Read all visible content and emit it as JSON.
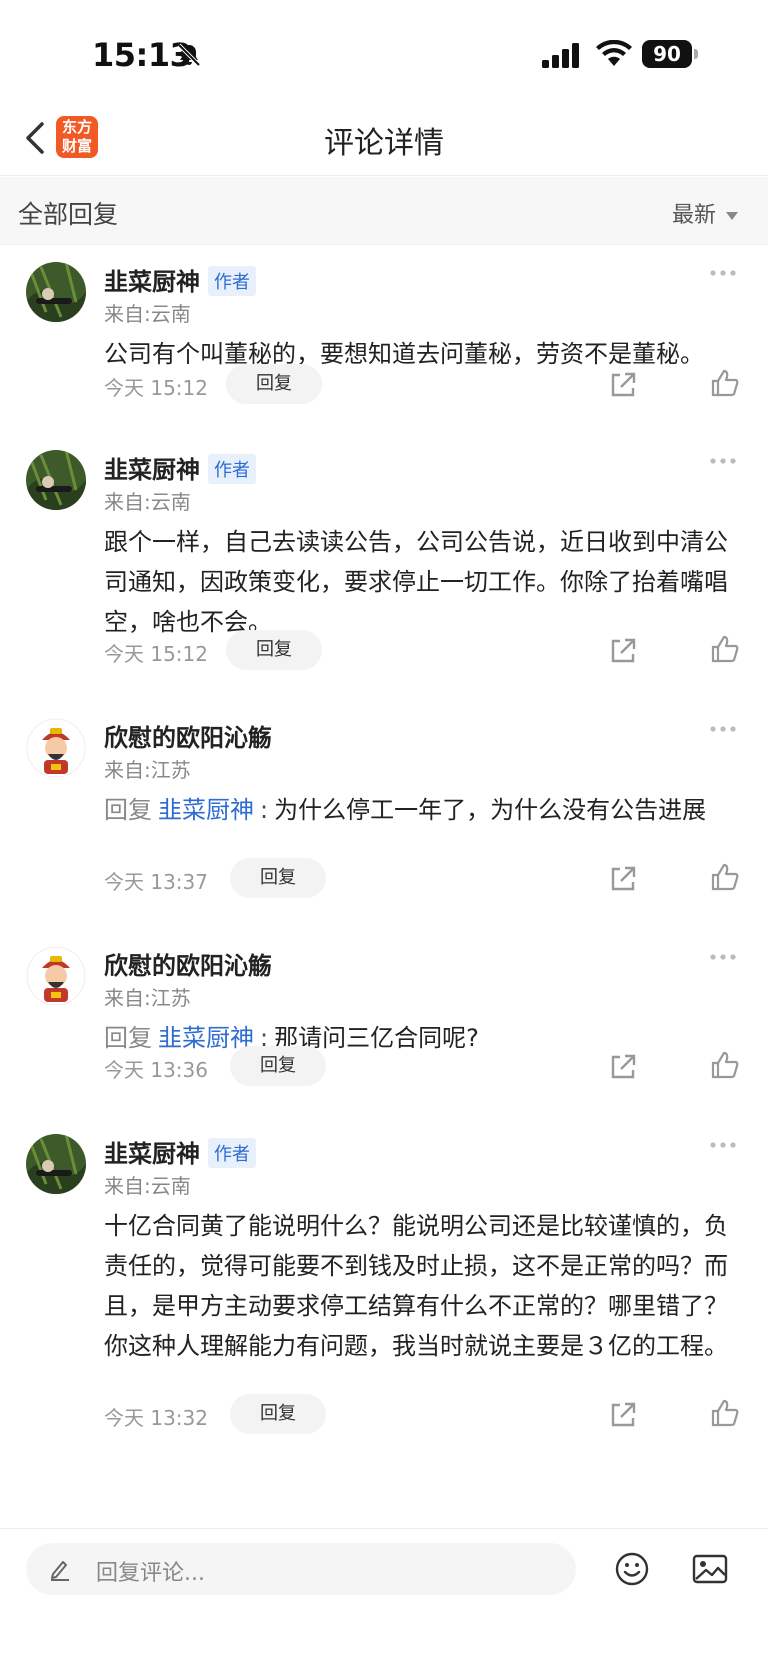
{
  "status_bar": {
    "time": "15:13",
    "battery": "90"
  },
  "nav": {
    "logo_line1": "东方",
    "logo_line2": "财富",
    "title": "评论详情"
  },
  "section": {
    "title": "全部回复",
    "sort": "最新"
  },
  "comments": [
    {
      "user": "韭菜厨神",
      "tag": "作者",
      "location": "来自:云南",
      "text": "公司有个叫董秘的，要想知道去问董秘，劳资不是董秘。",
      "time": "今天 15:12",
      "reply_label": "回复"
    },
    {
      "user": "韭菜厨神",
      "tag": "作者",
      "location": "来自:云南",
      "text": "跟个一样，自己去读读公告，公司公告说，近日收到中清公司通知，因政策变化，要求停止一切工作。你除了抬着嘴唱空，啥也不会。",
      "time": "今天 15:12",
      "reply_label": "回复"
    },
    {
      "user": "欣慰的欧阳沁觞",
      "location": "来自:江苏",
      "reply_prefix": "回复",
      "reply_to": "韭菜厨神",
      "text": "为什么停工一年了，为什么没有公告进展",
      "time": "今天 13:37",
      "reply_label": "回复"
    },
    {
      "user": "欣慰的欧阳沁觞",
      "location": "来自:江苏",
      "reply_prefix": "回复",
      "reply_to": "韭菜厨神",
      "text": "那请问三亿合同呢?",
      "time": "今天 13:36",
      "reply_label": "回复"
    },
    {
      "user": "韭菜厨神",
      "tag": "作者",
      "location": "来自:云南",
      "text": "十亿合同黄了能说明什么？能说明公司还是比较谨慎的，负责任的，觉得可能要不到钱及时止损，这不是正常的吗？而且，是甲方主动要求停工结算有什么不正常的？哪里错了？你这种人理解能力有问题，我当时就说主要是３亿的工程。",
      "time": "今天 13:32",
      "reply_label": "回复"
    }
  ],
  "bottom_bar": {
    "placeholder": "回复评论..."
  },
  "icons": {
    "back": "chevron-left-icon",
    "bell_off": "bell-slash-icon",
    "signal": "cellular-signal-icon",
    "wifi": "wifi-icon",
    "more": "more-dots-icon",
    "share": "share-icon",
    "like": "thumbs-up-icon",
    "pencil": "pencil-icon",
    "emoji": "emoji-icon",
    "image": "image-icon"
  },
  "colors": {
    "accent_blue": "#2e6cd1",
    "logo_orange": "#f15a24",
    "muted_gray": "#888888"
  }
}
